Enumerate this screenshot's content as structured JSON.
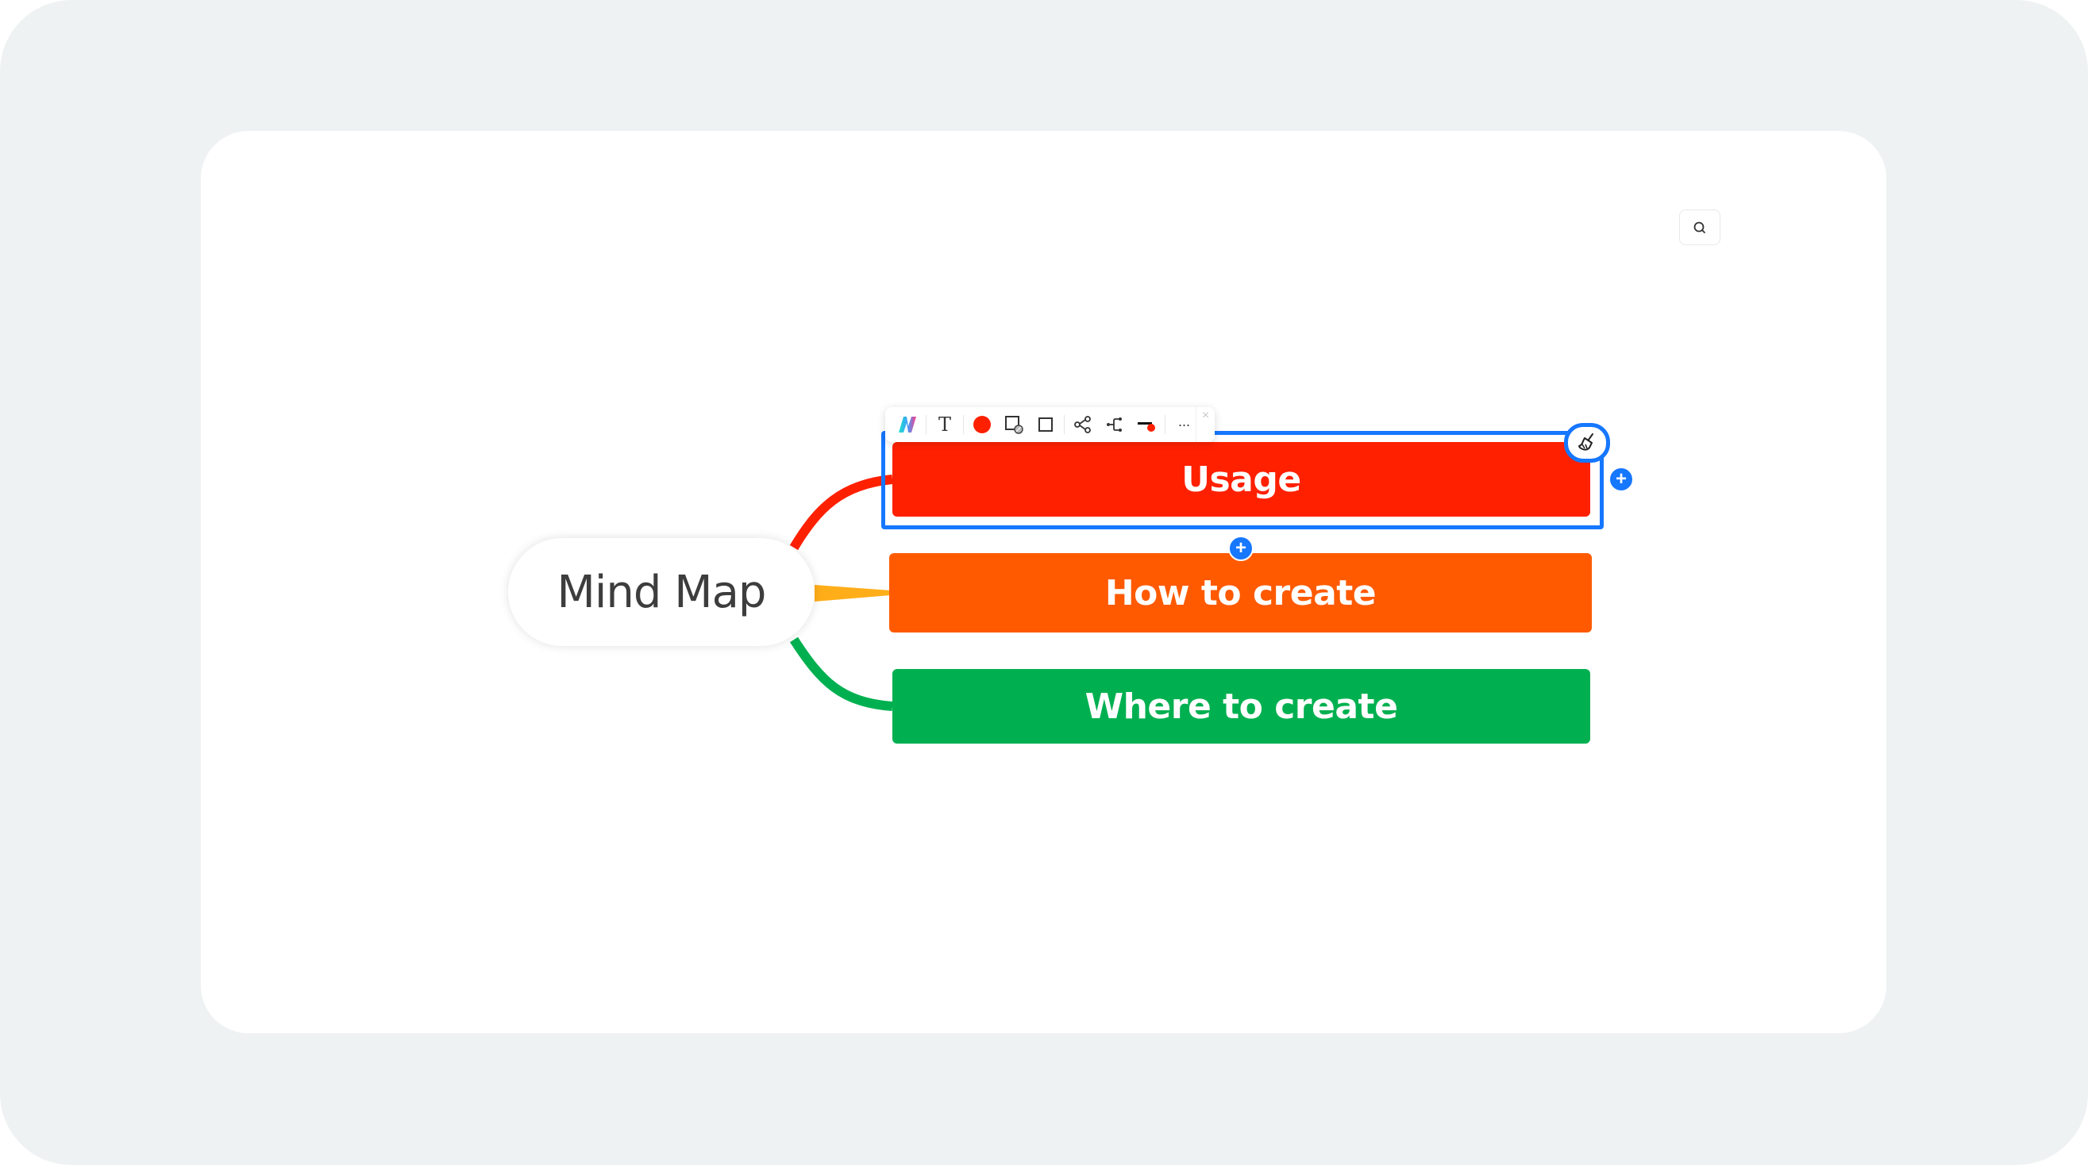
{
  "app": {
    "search_button_icon": "search-icon"
  },
  "mindmap": {
    "root": {
      "label": "Mind Map",
      "text_color": "#3d3d3d"
    },
    "branches": [
      {
        "label": "Usage",
        "color": "#ff2000",
        "link_color": "#ff2000",
        "selected": true
      },
      {
        "label": "How to create",
        "color": "#ff5a00",
        "link_color": "#ffae1a",
        "selected": false
      },
      {
        "label": "Where to create",
        "color": "#00b050",
        "link_color": "#00b050",
        "selected": false
      }
    ],
    "selection_color": "#1677ff"
  },
  "toolbar": {
    "items": [
      {
        "name": "ai-logo-icon"
      },
      {
        "name": "text-style-icon",
        "glyph": "T"
      },
      {
        "name": "fill-color-icon",
        "color": "#ff2000"
      },
      {
        "name": "border-style-icon"
      },
      {
        "name": "shape-icon"
      },
      {
        "name": "add-child-icon"
      },
      {
        "name": "layout-structure-icon"
      },
      {
        "name": "line-style-icon",
        "color": "#ff2000"
      },
      {
        "name": "more-icon",
        "glyph": "···"
      }
    ],
    "close_glyph": "×"
  },
  "handles": {
    "clear-style": "broom-icon",
    "add-sibling": "+",
    "add-child": "+"
  }
}
